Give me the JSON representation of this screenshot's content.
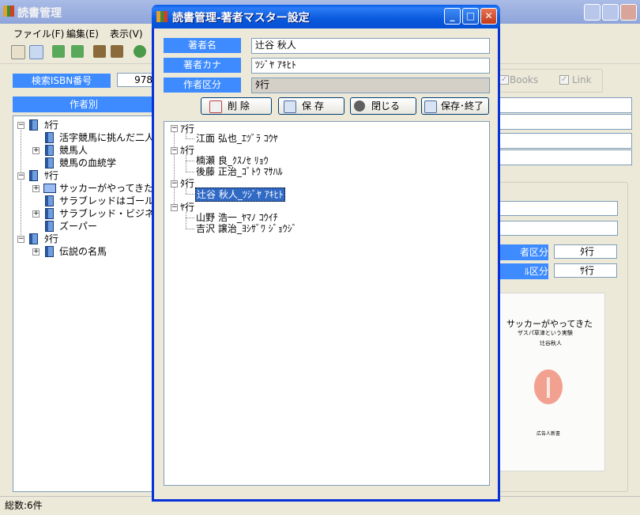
{
  "main_window": {
    "title": "読書管理",
    "menu": [
      "ファイル(F)",
      "編集(E)",
      "表示(V)"
    ],
    "search_label": "検索ISBN番号",
    "search_value": "978",
    "view_label": "作者別",
    "tree": [
      {
        "label": "ｶ行",
        "type": "group"
      },
      {
        "label": "活字競馬に挑んだ二人の",
        "type": "book"
      },
      {
        "label": "競馬人",
        "type": "book",
        "expandable": true
      },
      {
        "label": "競馬の血統学",
        "type": "book"
      },
      {
        "label": "ｻ行",
        "type": "group"
      },
      {
        "label": "サッカーがやってきた",
        "type": "book",
        "expandable": true,
        "open": true
      },
      {
        "label": "サラブレッドはゴール板を知",
        "type": "book"
      },
      {
        "label": "サラブレッド・ビジネス",
        "type": "book",
        "expandable": true
      },
      {
        "label": "ズーパー",
        "type": "book"
      },
      {
        "label": "ﾀ行",
        "type": "group"
      },
      {
        "label": "伝説の名馬",
        "type": "book",
        "expandable": true
      }
    ],
    "checkbox_books": "Books",
    "checkbox_link": "Link",
    "author_category_label": "者区分",
    "author_category_value": "ﾀ行",
    "title_category_label": "ﾙ区分",
    "title_category_value": "ｻ行",
    "cover": {
      "title": "サッカーがやってきた",
      "subtitle": "ザスパ草津という実験",
      "author": "辻谷秋人",
      "publisher": "広告人新書"
    },
    "status": "総数:6件"
  },
  "dialog": {
    "title": "読書管理-著者マスター設定",
    "fields": [
      {
        "label": "著者名",
        "value": "辻谷 秋人"
      },
      {
        "label": "著者カナ",
        "value": "ﾂｼﾞﾔ ｱｷﾋﾄ"
      },
      {
        "label": "作者区分",
        "value": "ﾀ行"
      }
    ],
    "buttons": {
      "delete": "削 除",
      "save": "保 存",
      "close": "閉じる",
      "save_close": "保存･終了"
    },
    "tree": [
      {
        "group": "ｱ行",
        "items": [
          "江面 弘也_ｴﾂﾞﾗ ｺｳﾔ"
        ]
      },
      {
        "group": "ｶ行",
        "items": [
          "楠瀬 良_ｸｽﾉｾ ﾘｮｳ",
          "後藤 正治_ｺﾞﾄｳ ﾏｻﾊﾙ"
        ]
      },
      {
        "group": "ﾀ行",
        "items": [
          "辻谷 秋人_ﾂｼﾞﾔ ｱｷﾋﾄ"
        ]
      },
      {
        "group": "ﾔ行",
        "items": [
          "山野 浩一_ﾔﾏﾉ ｺｳｲﾁ",
          "吉沢 譲治_ﾖｼｻﾞﾜ ｼﾞｮｳｼﾞ"
        ]
      }
    ],
    "selected_item": "辻谷 秋人_ﾂｼﾞﾔ ｱｷﾋﾄ"
  },
  "colors": {
    "label_blue": "#3d8bff",
    "dialog_title_blue": "#0a5ce8",
    "selection": "#316ac5",
    "inactive_title": "#a9bbe6"
  }
}
